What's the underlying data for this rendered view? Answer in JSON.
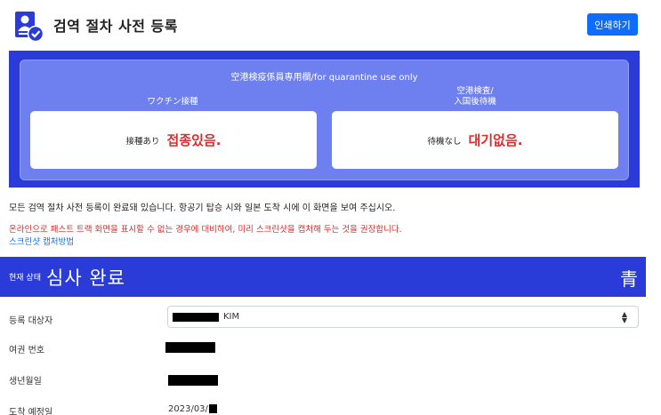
{
  "header": {
    "title": "검역 절차 사전 등록",
    "print_label": "인쇄하기"
  },
  "quarantine": {
    "heading": "空港検疫係員専用欄/for quarantine use only",
    "vaccine_label": "ワクチン接種",
    "airport_label_line1": "空港検査/",
    "airport_label_line2": "入国後待機",
    "vaccine_small": "接種あり",
    "vaccine_big": "접종있음.",
    "wait_small": "待機なし",
    "wait_big": "대기없음."
  },
  "messages": {
    "complete": "모든 검역 절차 사전 등록이 완료돼 있습니다. 항공기 탑승 시와 일본 도착 시에 이 화면을 보여 주십시오.",
    "warning": "온라인으로 패스트 트랙 화면을 표시할 수 없는 경우에 대비하여, 미리 스크린샷을 캡처해 두는 것을 권장합니다.",
    "howto_link": "스크린샷 캡처방법"
  },
  "status": {
    "current_label": "현재 상태",
    "value": "심사 완료",
    "color_label": "青"
  },
  "form": {
    "registrant_label": "등록 대상자",
    "registrant_value": "KIM",
    "passport_label": "여권 번호",
    "birth_label": "생년월일",
    "arrival_label": "도착 예정일",
    "arrival_value": "2023/03/"
  },
  "colors": {
    "primary_blue": "#2a3bd8",
    "panel_inner": "#6e80ef",
    "button_blue": "#0d6efd",
    "alert_red": "#e0292b"
  }
}
